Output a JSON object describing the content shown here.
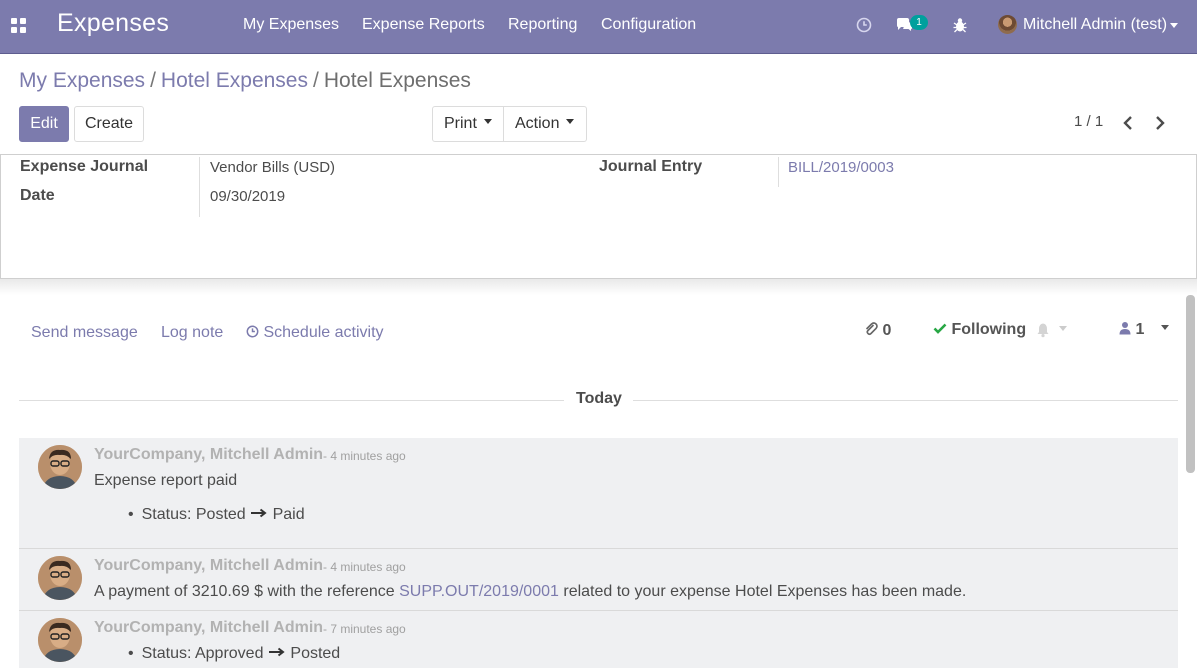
{
  "navbar": {
    "app_title": "Expenses",
    "menu": [
      "My Expenses",
      "Expense Reports",
      "Reporting",
      "Configuration"
    ],
    "messages_badge": "1",
    "user": "Mitchell Admin (test)",
    "bg_color": "#7c7bad"
  },
  "breadcrumb": {
    "items": [
      "My Expenses",
      "Hotel Expenses"
    ],
    "separator": "/",
    "current": "Hotel Expenses"
  },
  "buttons": {
    "edit": "Edit",
    "create": "Create",
    "print": "Print",
    "action": "Action"
  },
  "pager": {
    "value": "1 / 1"
  },
  "form": {
    "journal_label": "Expense Journal",
    "journal_value": "Vendor Bills (USD)",
    "date_label": "Date",
    "date_value": "09/30/2019",
    "entry_label": "Journal Entry",
    "entry_value": "BILL/2019/0003"
  },
  "chatter": {
    "send_message": "Send message",
    "log_note": "Log note",
    "schedule_activity": "Schedule activity",
    "attachments": "0",
    "following": "Following",
    "followers": "1",
    "today": "Today",
    "messages": [
      {
        "author": "YourCompany, Mitchell Admin",
        "time": "- 4 minutes ago",
        "body": "Expense report paid",
        "tracking_label": "Status:",
        "tracking_old": "Posted",
        "tracking_new": "Paid"
      },
      {
        "author": "YourCompany, Mitchell Admin",
        "time": "- 4 minutes ago",
        "body_prefix": "A payment of 3210.69 $ with the reference",
        "body_link": "SUPP.OUT/2019/0001",
        "body_suffix": "related to your expense Hotel Expenses has been made."
      },
      {
        "author": "YourCompany, Mitchell Admin",
        "time": "- 7 minutes ago",
        "tracking_label": "Status:",
        "tracking_old": "Approved",
        "tracking_new": "Posted"
      }
    ]
  },
  "icons": {
    "apps": "apps-grid-icon",
    "activity": "clock-icon",
    "messaging": "chat-icon",
    "debug": "bug-icon",
    "prev": "chevron-left-icon",
    "next": "chevron-right-icon",
    "paperclip": "paperclip-icon",
    "check": "check-icon",
    "bell": "bell-icon",
    "followers": "user-icon",
    "arrow": "arrow-right-icon"
  },
  "colors": {
    "primary": "#7c7bad",
    "badge": "#00a09d",
    "check": "#28a745",
    "message_bg": "#eff0f2"
  }
}
